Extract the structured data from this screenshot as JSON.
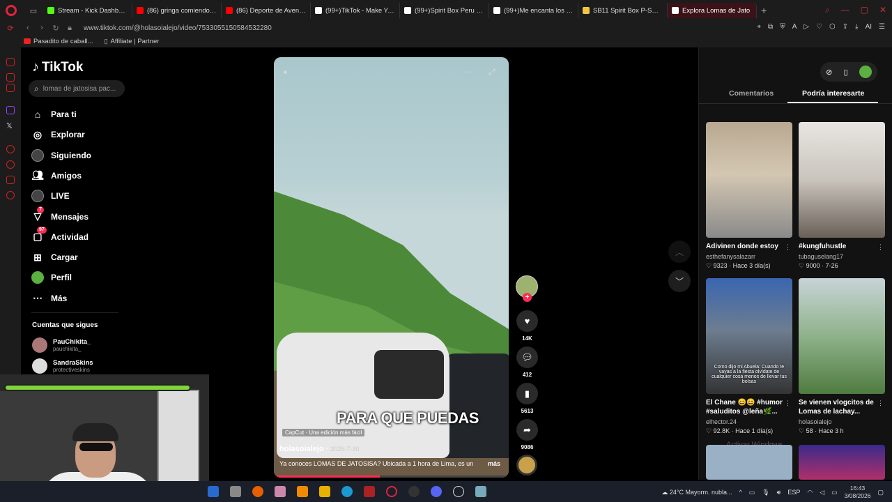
{
  "browser": {
    "tabs": [
      {
        "title": "Stream - Kick Dashboard",
        "color": "#53fc18"
      },
      {
        "title": "(86) gringa comiendo gato",
        "color": "#ff0000"
      },
      {
        "title": "(86) Deporte de Aventura",
        "color": "#ff0000"
      },
      {
        "title": "(99+)TikTok - Make Your D",
        "color": "#ffffff"
      },
      {
        "title": "(99+)Spirit Box Peru | TikT",
        "color": "#ffffff"
      },
      {
        "title": "(99+)Me encanta los corra",
        "color": "#ffffff"
      },
      {
        "title": "SB11 Spirit Box P-SB11 Gho",
        "color": "#f4c542"
      },
      {
        "title": "Explora Lomas de Jato",
        "color": "#ffffff",
        "active": true
      }
    ],
    "url": "www.tiktok.com/@holasoialejo/video/7533055150584532280",
    "bookmarks": [
      "Pasadito de caball...",
      "Affiliate | Partner"
    ],
    "ext_ai_label": "AI"
  },
  "sidebar": {
    "logo": "TikTok",
    "search_text": "lomas de jatosisa pac...",
    "nav": [
      {
        "label": "Para ti",
        "icon": "home-icon"
      },
      {
        "label": "Explorar",
        "icon": "compass-icon"
      },
      {
        "label": "Siguiendo",
        "icon": "following-avatar-icon"
      },
      {
        "label": "Amigos",
        "icon": "friends-icon"
      },
      {
        "label": "LIVE",
        "icon": "live-icon"
      },
      {
        "label": "Mensajes",
        "icon": "inbox-icon",
        "badge": "7"
      },
      {
        "label": "Actividad",
        "icon": "activity-icon",
        "badge": "97"
      },
      {
        "label": "Cargar",
        "icon": "upload-icon"
      },
      {
        "label": "Perfil",
        "icon": "profile-icon"
      },
      {
        "label": "Más",
        "icon": "more-icon"
      }
    ],
    "following_title": "Cuentas que sigues",
    "following": [
      {
        "name": "PauChikita_",
        "handle": "pauchikita_"
      },
      {
        "name": "SandraSkins",
        "handle": "protectiveskins"
      }
    ]
  },
  "video": {
    "caption_overlay": "PARA QUE PUEDAS",
    "capcut_label": "CapCut · Una edición más fácil",
    "author": "holasoialejo",
    "date": "2025-7-30",
    "description": "Ya conoces LOMAS DE JATOSISA? Ubicada a 1 hora de Lima, es un",
    "more_label": "más",
    "progress": 0.45
  },
  "actions": {
    "likes": "14K",
    "comments": "412",
    "saves": "5613",
    "shares": "9086"
  },
  "right_panel": {
    "tabs": [
      "Comentarios",
      "Podría interesarte"
    ],
    "active_tab": 1,
    "cards": [
      {
        "title": "Adivinen donde estoy",
        "user": "esthefanysalazarr",
        "likes": "9323",
        "time": "Hace 3 día(s)",
        "overlay": ""
      },
      {
        "title": "#kungfuhustle",
        "user": "tubaguselang17",
        "likes": "9000",
        "time": "7-26",
        "overlay": ""
      },
      {
        "title": "El Chane 😄😄 #humor #saluditos @leña🌿...",
        "user": "elhector.24",
        "likes": "92.8K",
        "time": "Hace 1 día(s)",
        "overlay": "Como dijo mi Abuela: Cuando te vayas a la fiesta olvídate de cualquier cosa menos de llevar tus bolsas"
      },
      {
        "title": "Se vienen vlogcitos de Lomas de lachay...",
        "user": "holasoialejo",
        "likes": "58",
        "time": "Hace 3 h",
        "overlay": ""
      }
    ],
    "watermark": "Activar Windows"
  },
  "taskbar": {
    "weather": "24°C  Mayorm. nubla...",
    "lang": "ESP",
    "time": "16:43",
    "date": "3/08/2026"
  }
}
